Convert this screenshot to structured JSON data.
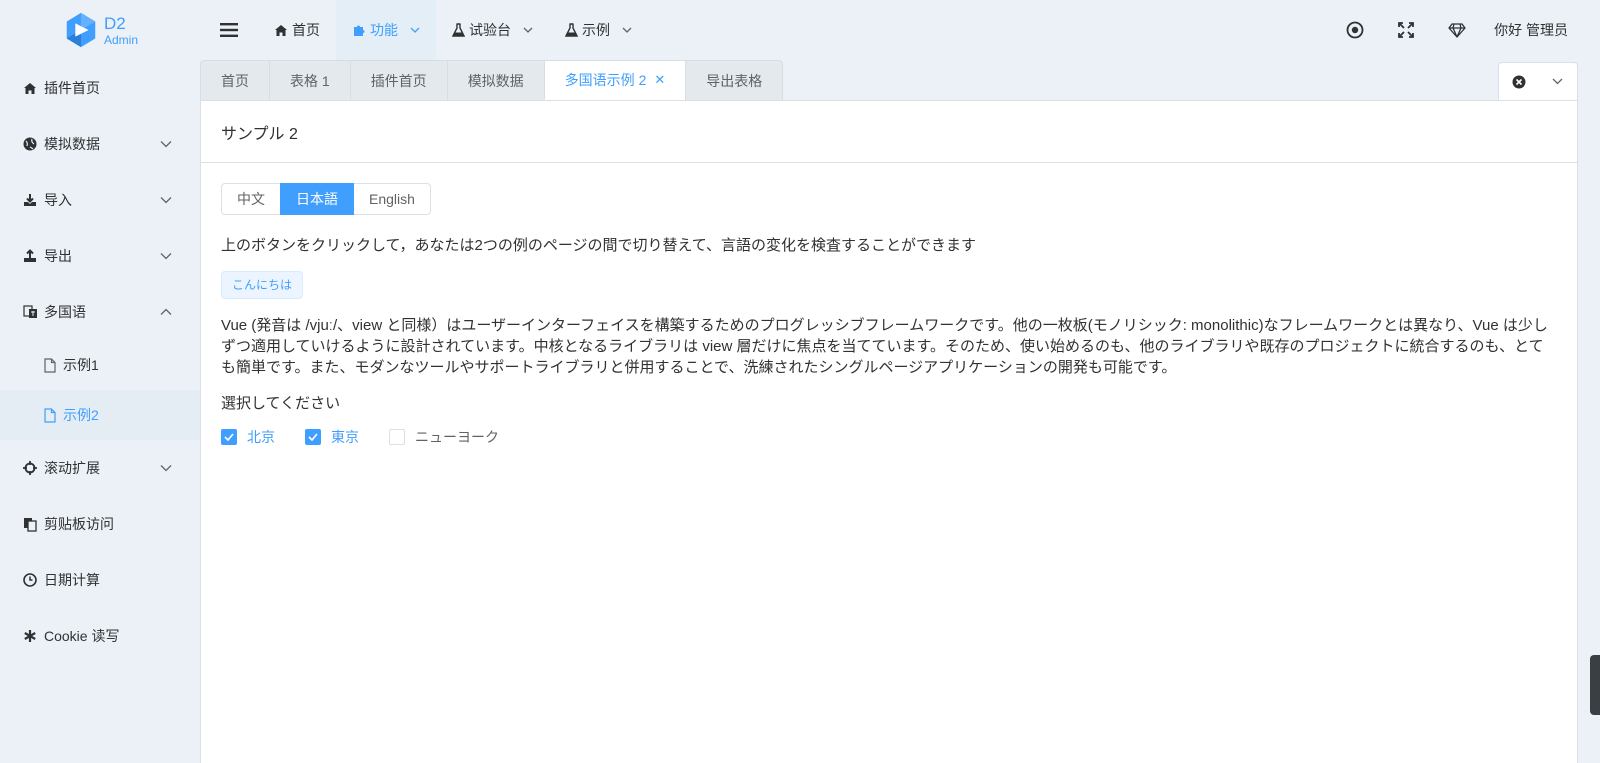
{
  "logo": {
    "title": "D2",
    "subtitle": "Admin"
  },
  "header": {
    "menu": [
      {
        "label": "首页",
        "icon": "home-icon"
      },
      {
        "label": "功能",
        "icon": "puzzle-icon",
        "active": true,
        "dropdown": true
      },
      {
        "label": "试验台",
        "icon": "flask-icon",
        "dropdown": true
      },
      {
        "label": "示例",
        "icon": "flask-icon",
        "dropdown": true
      }
    ],
    "user": "你好 管理员"
  },
  "sidebar": {
    "items": [
      {
        "label": "插件首页",
        "icon": "home-icon"
      },
      {
        "label": "模拟数据",
        "icon": "globe-icon",
        "chevron": "down"
      },
      {
        "label": "导入",
        "icon": "download-icon",
        "chevron": "down"
      },
      {
        "label": "导出",
        "icon": "upload-icon",
        "chevron": "down"
      },
      {
        "label": "多国语",
        "icon": "language-icon",
        "chevron": "up"
      },
      {
        "label": "示例1",
        "icon": "file-icon"
      },
      {
        "label": "示例2",
        "icon": "file-icon",
        "active": true
      },
      {
        "label": "滚动扩展",
        "icon": "crosshair-icon",
        "chevron": "down"
      },
      {
        "label": "剪贴板访问",
        "icon": "clipboard-icon"
      },
      {
        "label": "日期计算",
        "icon": "clock-icon"
      },
      {
        "label": "Cookie 读写",
        "icon": "asterisk-icon"
      }
    ]
  },
  "tabs": [
    {
      "label": "首页"
    },
    {
      "label": "表格 1"
    },
    {
      "label": "插件首页"
    },
    {
      "label": "模拟数据"
    },
    {
      "label": "多国语示例 2",
      "active": true,
      "closable": true
    },
    {
      "label": "导出表格"
    }
  ],
  "page": {
    "title": "サンプル 2",
    "lang_buttons": [
      "中文",
      "日本語",
      "English"
    ],
    "active_lang": "日本語",
    "intro": "上のボタンをクリックして，あなたは2つの例のページの間で切り替えて、言語の変化を検査することができます",
    "tag": "こんにちは",
    "description": "Vue (発音は /vjuː/、view と同様）はユーザーインターフェイスを構築するためのプログレッシブフレームワークです。他の一枚板(モノリシック: monolithic)なフレームワークとは異なり、Vue は少しずつ適用していけるように設計されています。中核となるライブラリは view 層だけに焦点を当てています。そのため、使い始めるのも、他のライブラリや既存のプロジェクトに統合するのも、とても簡単です。また、モダンなツールやサポートライブラリと併用することで、洗練されたシングルページアプリケーションの開発も可能です。",
    "select_prompt": "選択してください",
    "checkboxes": [
      {
        "label": "北京",
        "checked": true
      },
      {
        "label": "東京",
        "checked": true
      },
      {
        "label": "ニューヨーク",
        "checked": false
      }
    ]
  },
  "colors": {
    "accent": "#409eff",
    "background": "#ebf1f6",
    "text": "#303133"
  }
}
